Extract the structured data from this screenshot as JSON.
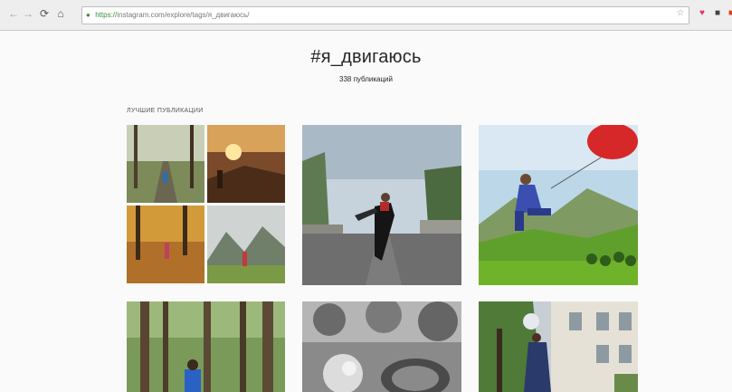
{
  "browser": {
    "url_scheme": "https://",
    "url_rest": "instagram.com/explore/tags/я_двигаюсь/",
    "icons": [
      "back-icon",
      "forward-icon",
      "reload-icon",
      "home-icon",
      "lock-icon",
      "star-icon",
      "pocket-icon",
      "shield-icon",
      "extension-icon"
    ]
  },
  "page": {
    "hashtag": "#я_двигаюсь",
    "post_count": "338 публикаций",
    "section_label": "ЛУЧШИЕ ПУБЛИКАЦИИ"
  },
  "posts": [
    {
      "description": "collage: forest path, sunset runner, autumn forest, mountain trail"
    },
    {
      "description": "dancer leaping on city street"
    },
    {
      "description": "girl flying with red balloon over green hills"
    },
    {
      "description": "tall trees in forest with person"
    },
    {
      "description": "black and white garden scene"
    },
    {
      "description": "woman with flowers near building"
    }
  ],
  "colors": {
    "toolbar_bg": "#eeeeee",
    "page_bg": "#fafafa",
    "text": "#262626",
    "secure": "#3a8f3a"
  }
}
